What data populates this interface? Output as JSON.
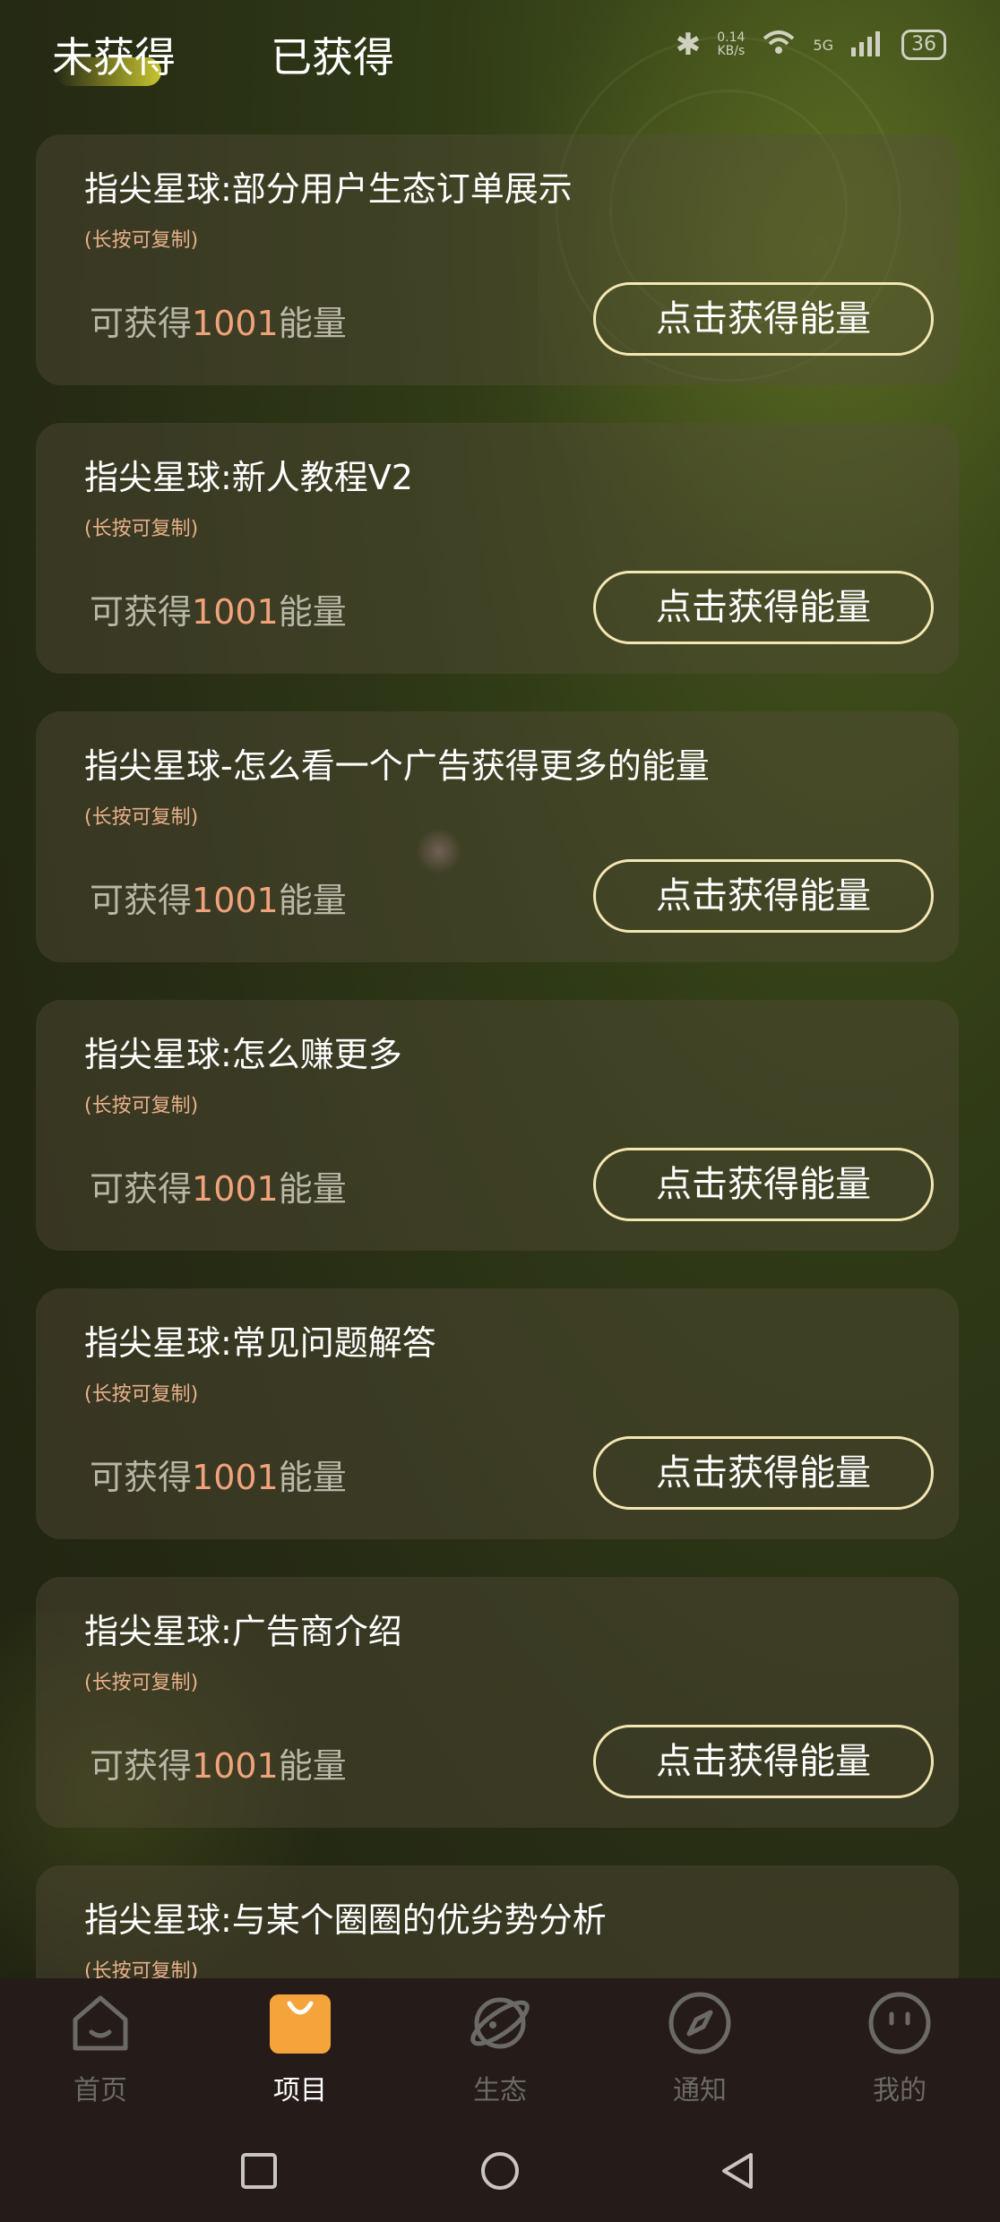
{
  "tabs": {
    "unobtained": "未获得",
    "obtained": "已获得"
  },
  "status_bar": {
    "speed_value": "0.14",
    "speed_unit": "KB/s",
    "network": "5G",
    "battery": "36"
  },
  "cards": [
    {
      "title": "指尖星球:部分用户生态订单展示",
      "hint": "(长按可复制)",
      "reward_prefix": "可获得",
      "reward_amount": "1001",
      "reward_suffix": "能量",
      "button": "点击获得能量"
    },
    {
      "title": "指尖星球:新人教程V2",
      "hint": "(长按可复制)",
      "reward_prefix": "可获得",
      "reward_amount": "1001",
      "reward_suffix": "能量",
      "button": "点击获得能量"
    },
    {
      "title": "指尖星球-怎么看一个广告获得更多的能量",
      "hint": "(长按可复制)",
      "reward_prefix": "可获得",
      "reward_amount": "1001",
      "reward_suffix": "能量",
      "button": "点击获得能量"
    },
    {
      "title": "指尖星球:怎么赚更多",
      "hint": "(长按可复制)",
      "reward_prefix": "可获得",
      "reward_amount": "1001",
      "reward_suffix": "能量",
      "button": "点击获得能量"
    },
    {
      "title": "指尖星球:常见问题解答",
      "hint": "(长按可复制)",
      "reward_prefix": "可获得",
      "reward_amount": "1001",
      "reward_suffix": "能量",
      "button": "点击获得能量"
    },
    {
      "title": "指尖星球:广告商介绍",
      "hint": "(长按可复制)",
      "reward_prefix": "可获得",
      "reward_amount": "1001",
      "reward_suffix": "能量",
      "button": "点击获得能量"
    },
    {
      "title": "指尖星球:与某个圈圈的优劣势分析",
      "hint": "(长按可复制)"
    }
  ],
  "nav": [
    {
      "label": "首页",
      "icon": "home-icon"
    },
    {
      "label": "项目",
      "icon": "shopping-bag-icon"
    },
    {
      "label": "生态",
      "icon": "planet-icon"
    },
    {
      "label": "通知",
      "icon": "compass-icon"
    },
    {
      "label": "我的",
      "icon": "profile-face-icon"
    }
  ],
  "colors": {
    "accent_orange": "#f5a43c",
    "button_border": "#f4e7b3",
    "reward_number": "#f0a27a",
    "hint_text": "#e8b08a"
  }
}
